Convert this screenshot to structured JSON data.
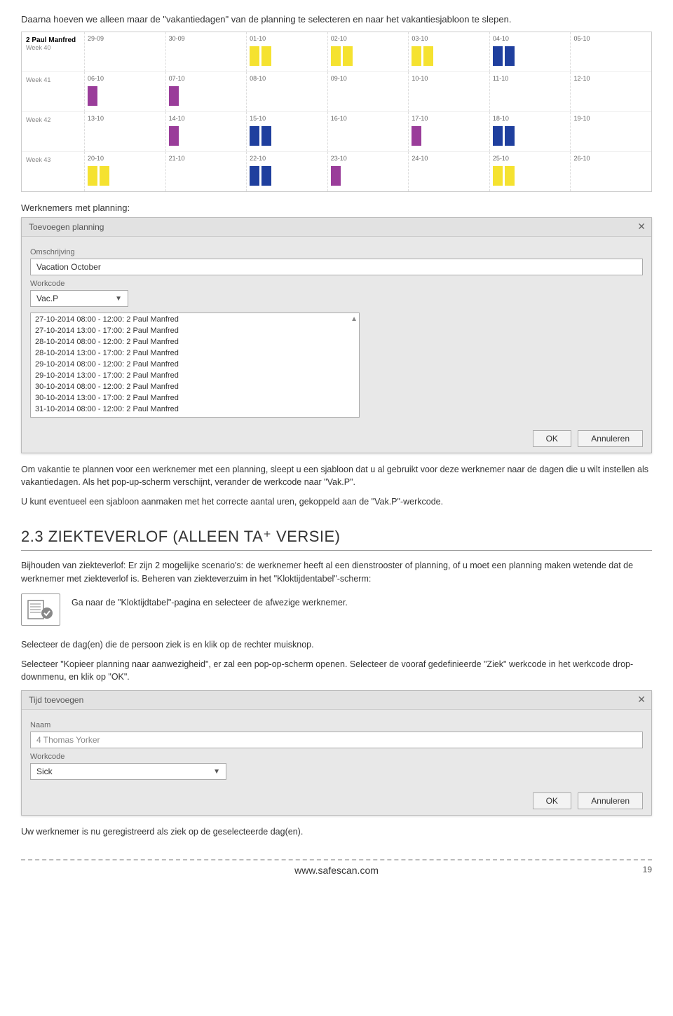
{
  "intro": "Daarna hoeven we alleen maar de \"vakantiedagen\" van de planning te selecteren en naar het vakantiesjabloon te slepen.",
  "calendar": {
    "employee": "2 Paul Manfred",
    "rows": [
      {
        "label_top": "2 Paul Manfred",
        "label_bottom": "Week 40",
        "days": [
          {
            "date": "29-09",
            "blocks": []
          },
          {
            "date": "30-09",
            "blocks": []
          },
          {
            "date": "01-10",
            "blocks": [
              "yellow",
              "yellow"
            ]
          },
          {
            "date": "02-10",
            "blocks": [
              "yellow",
              "yellow"
            ]
          },
          {
            "date": "03-10",
            "blocks": [
              "yellow",
              "yellow"
            ]
          },
          {
            "date": "04-10",
            "blocks": [
              "blue",
              "blue"
            ]
          },
          {
            "date": "05-10",
            "blocks": []
          }
        ]
      },
      {
        "label_top": "",
        "label_bottom": "Week 41",
        "days": [
          {
            "date": "06-10",
            "blocks": [
              "purple"
            ]
          },
          {
            "date": "07-10",
            "blocks": [
              "purple"
            ]
          },
          {
            "date": "08-10",
            "blocks": []
          },
          {
            "date": "09-10",
            "blocks": []
          },
          {
            "date": "10-10",
            "blocks": []
          },
          {
            "date": "11-10",
            "blocks": []
          },
          {
            "date": "12-10",
            "blocks": []
          }
        ]
      },
      {
        "label_top": "",
        "label_bottom": "Week 42",
        "days": [
          {
            "date": "13-10",
            "blocks": []
          },
          {
            "date": "14-10",
            "blocks": [
              "purple"
            ]
          },
          {
            "date": "15-10",
            "blocks": [
              "blue",
              "blue"
            ]
          },
          {
            "date": "16-10",
            "blocks": []
          },
          {
            "date": "17-10",
            "blocks": [
              "purple"
            ]
          },
          {
            "date": "18-10",
            "blocks": [
              "blue",
              "blue"
            ]
          },
          {
            "date": "19-10",
            "blocks": []
          }
        ]
      },
      {
        "label_top": "",
        "label_bottom": "Week 43",
        "days": [
          {
            "date": "20-10",
            "blocks": [
              "yellow",
              "yellow"
            ]
          },
          {
            "date": "21-10",
            "blocks": []
          },
          {
            "date": "22-10",
            "blocks": [
              "blue",
              "blue"
            ]
          },
          {
            "date": "23-10",
            "blocks": [
              "purple"
            ]
          },
          {
            "date": "24-10",
            "blocks": []
          },
          {
            "date": "25-10",
            "blocks": [
              "yellow",
              "yellow"
            ]
          },
          {
            "date": "26-10",
            "blocks": []
          }
        ]
      }
    ]
  },
  "section1_title": "Werknemers met planning:",
  "dialog1": {
    "title": "Toevoegen planning",
    "field_omschrijving_label": "Omschrijving",
    "field_omschrijving_value": "Vacation October",
    "field_workcode_label": "Workcode",
    "field_workcode_value": "Vac.P",
    "list": [
      "27-10-2014 08:00 - 12:00: 2 Paul Manfred",
      "27-10-2014 13:00 - 17:00: 2 Paul Manfred",
      "28-10-2014 08:00 - 12:00: 2 Paul Manfred",
      "28-10-2014 13:00 - 17:00: 2 Paul Manfred",
      "29-10-2014 08:00 - 12:00: 2 Paul Manfred",
      "29-10-2014 13:00 - 17:00: 2 Paul Manfred",
      "30-10-2014 08:00 - 12:00: 2 Paul Manfred",
      "30-10-2014 13:00 - 17:00: 2 Paul Manfred",
      "31-10-2014 08:00 - 12:00: 2 Paul Manfred"
    ],
    "ok": "OK",
    "cancel": "Annuleren"
  },
  "para1": "Om vakantie te plannen voor een werknemer met een planning, sleept u een sjabloon dat u al gebruikt voor deze werknemer naar de dagen die u wilt instellen als vakantiedagen. Als het pop-up-scherm verschijnt, verander de werkcode naar \"Vak.P\".",
  "para2": "U kunt eventueel een sjabloon aanmaken met het correcte aantal uren, gekoppeld aan de \"Vak.P\"-werkcode.",
  "heading23": "2.3 ZIEKTEVERLOF (ALLEEN TA⁺ VERSIE)",
  "para3": "Bijhouden van ziekteverlof:  Er zijn 2 mogelijke scenario's: de werknemer heeft al een dienstrooster of planning, of u moet een planning maken wetende dat de werknemer met ziekteverlof is. Beheren van ziekteverzuim in het \"Kloktijdentabel\"-scherm:",
  "callout_text": "Ga naar de \"Kloktijdtabel\"-pagina en selecteer de afwezige werknemer.",
  "para4": "Selecteer de dag(en) die de persoon ziek is en klik op de rechter muisknop.",
  "para5": "Selecteer \"Kopieer planning naar aanwezigheid\", er zal een pop-op-scherm openen. Selecteer de vooraf gedefinieerde \"Ziek\" werkcode in het werkcode drop-downmenu, en klik op \"OK\".",
  "dialog2": {
    "title": "Tijd toevoegen",
    "field_naam_label": "Naam",
    "field_naam_value": "4 Thomas Yorker",
    "field_workcode_label": "Workcode",
    "field_workcode_value": "Sick",
    "ok": "OK",
    "cancel": "Annuleren"
  },
  "para6": "Uw werknemer is nu geregistreerd als ziek op de geselecteerde dag(en).",
  "footer_url": "www.safescan.com",
  "page_number": "19"
}
